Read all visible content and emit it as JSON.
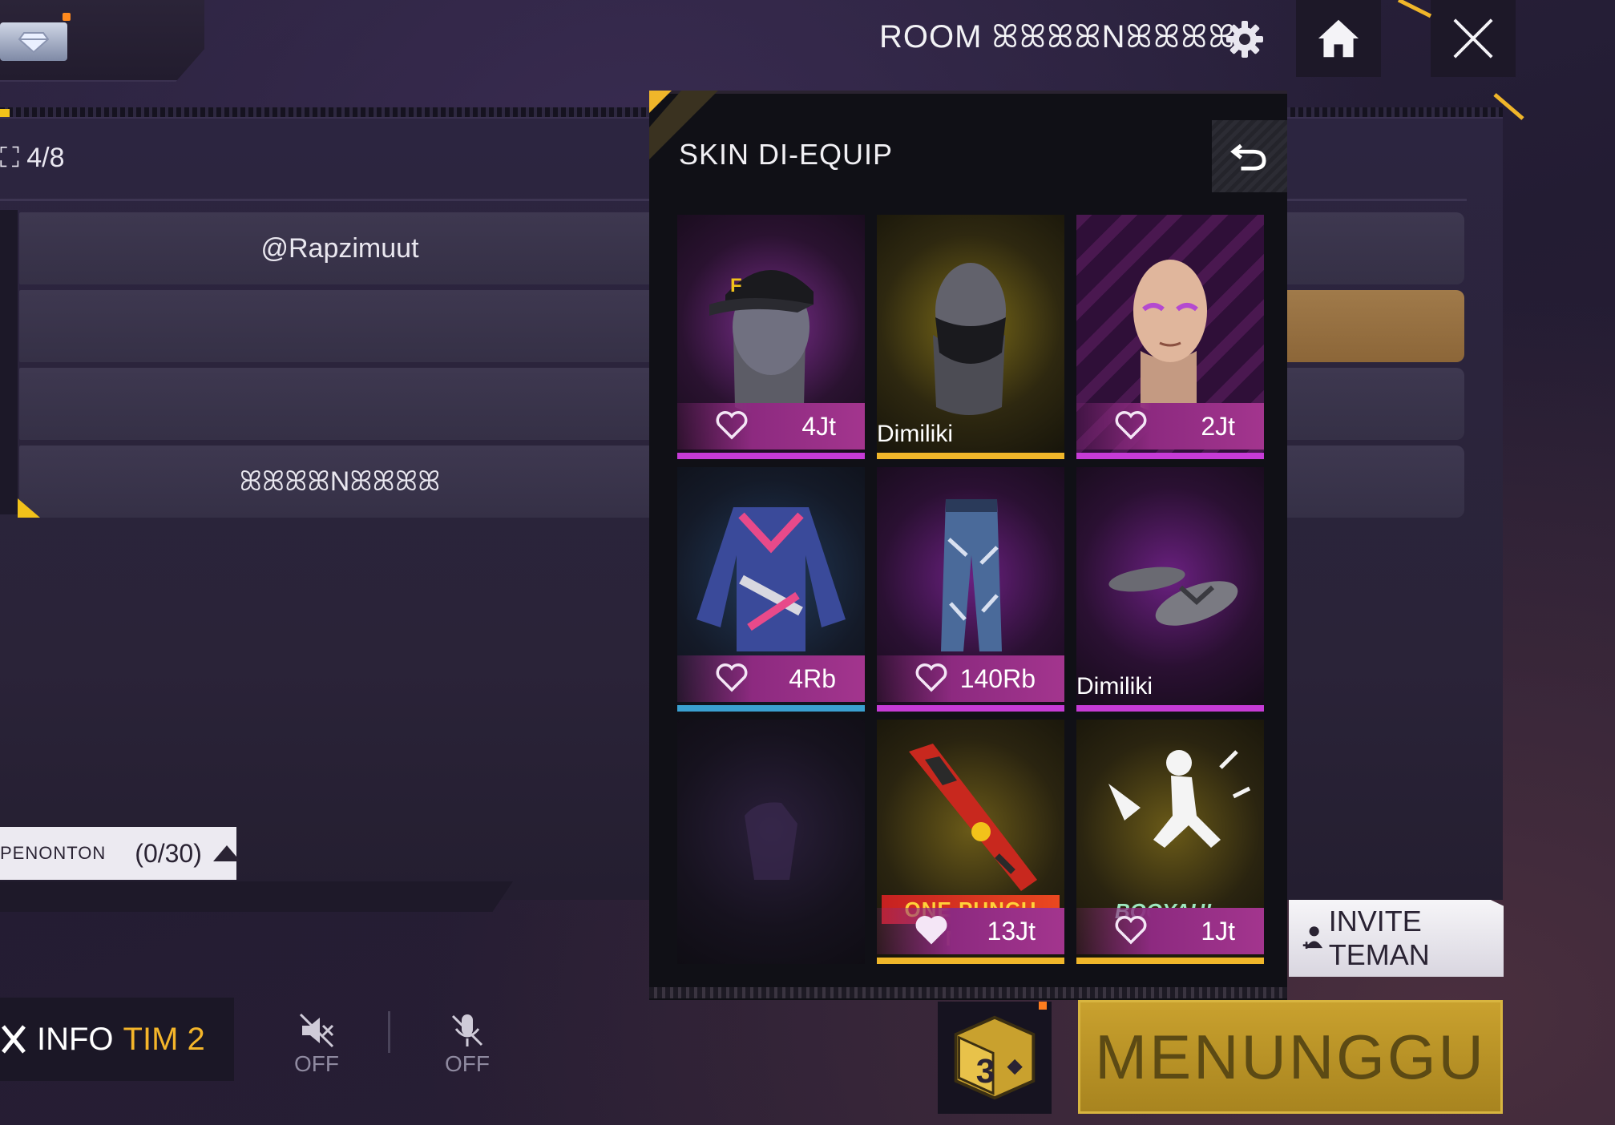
{
  "room": {
    "label": "ROOM ꕤꕤꕤꕤNꕤꕤꕤꕤ"
  },
  "lobby": {
    "player_count": "4/8",
    "slots": [
      "@Rapzimuut",
      "",
      "",
      "ꕤꕤꕤꕤNꕤꕤꕤꕤ"
    ]
  },
  "spectator": {
    "label": "PENONTON",
    "count": "(0/30)"
  },
  "bottom": {
    "info_prefix": "INFO",
    "info_team": "TIM 2",
    "speaker": "OFF",
    "mic": "OFF",
    "invite": "INVITE TEMAN",
    "dice_number": "3",
    "ready": "MENUNGGU"
  },
  "popup": {
    "title": "SKIN DI-EQUIP",
    "items": [
      {
        "type": "hat",
        "likes": "4Jt",
        "owned": "",
        "rarity": "purple"
      },
      {
        "type": "mask",
        "likes": "",
        "owned": "Dimiliki",
        "rarity": "gold"
      },
      {
        "type": "face",
        "likes": "2Jt",
        "owned": "",
        "rarity": "purple"
      },
      {
        "type": "jacket",
        "likes": "4Rb",
        "owned": "",
        "rarity": "blue"
      },
      {
        "type": "pants",
        "likes": "140Rb",
        "owned": "",
        "rarity": "purple"
      },
      {
        "type": "shoes",
        "likes": "",
        "owned": "Dimiliki",
        "rarity": "purple"
      },
      {
        "type": "empty",
        "likes": "",
        "owned": "",
        "rarity": "none"
      },
      {
        "type": "weapon",
        "likes": "13Jt",
        "owned": "",
        "rarity": "gold",
        "banner": "ONE PUNCH MAN"
      },
      {
        "type": "emote",
        "likes": "1Jt",
        "owned": "",
        "rarity": "gold",
        "banner": "BOOYAH!"
      }
    ]
  },
  "colors": {
    "accent": "#f2c21a",
    "rarity_purple": "#c63bd6",
    "rarity_gold": "#f0b62a",
    "rarity_blue": "#3aa0d0",
    "panel": "#101016"
  }
}
